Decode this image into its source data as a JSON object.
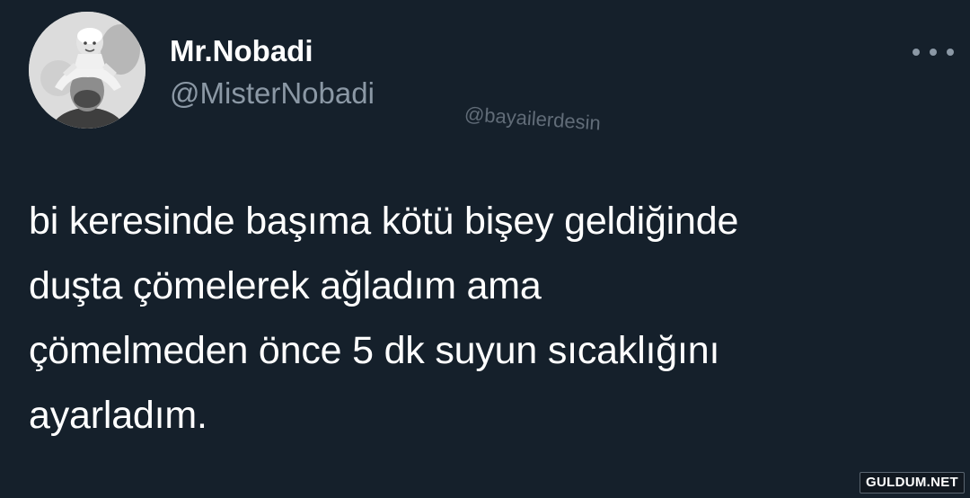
{
  "user": {
    "display_name": "Mr.Nobadi",
    "handle": "@MisterNobadi"
  },
  "watermark": "@bayailerdesin",
  "tweet": {
    "lines": [
      "bi keresinde başıma kötü bişey geldiğinde",
      "duşta çömelerek ağladım ama",
      "çömelmeden önce 5 dk suyun sıcaklığını",
      "ayarladım."
    ]
  },
  "site_mark": "GULDUM.NET",
  "icons": {
    "more": "more-options-icon",
    "avatar": "profile-photo"
  },
  "colors": {
    "background": "#15202b",
    "text": "#ffffff",
    "secondary_text": "#8b98a5"
  }
}
